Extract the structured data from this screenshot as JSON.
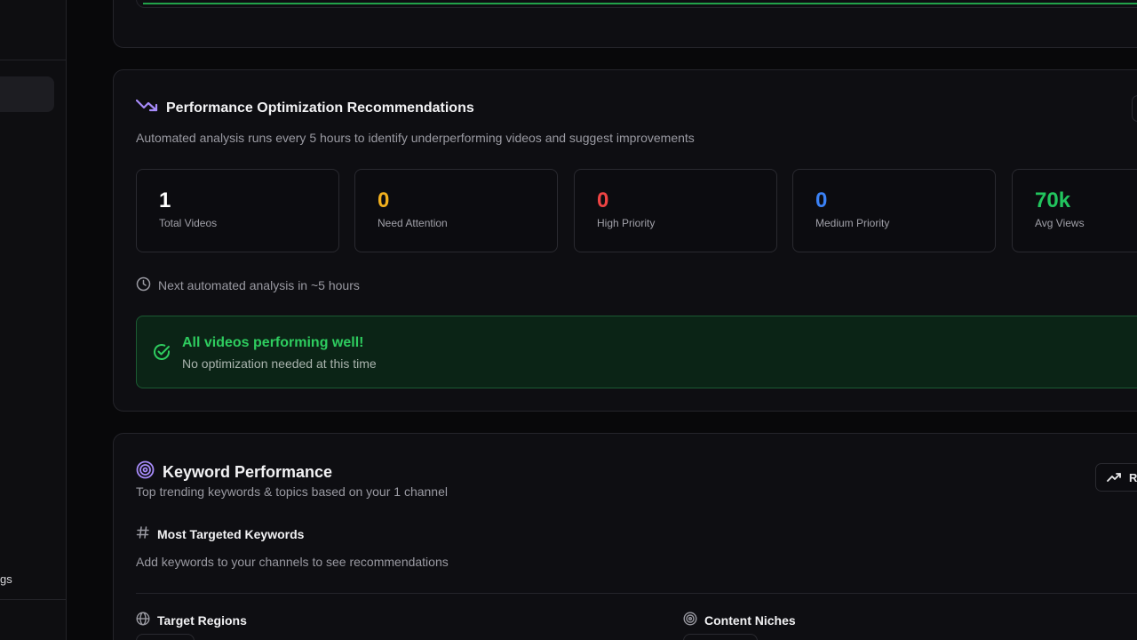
{
  "sidebar": {
    "partial_label": "gs"
  },
  "performance": {
    "title": "Performance Optimization Recommendations",
    "subtitle": "Automated analysis runs every 5 hours to identify underperforming videos and suggest improvements",
    "stats": [
      {
        "value": "1",
        "label": "Total Videos",
        "color": "#ffffff"
      },
      {
        "value": "0",
        "label": "Need Attention",
        "color": "#f2b01e"
      },
      {
        "value": "0",
        "label": "High Priority",
        "color": "#ef4444"
      },
      {
        "value": "0",
        "label": "Medium Priority",
        "color": "#3b82f6"
      },
      {
        "value": "70k",
        "label": "Avg Views",
        "color": "#22c55e"
      }
    ],
    "next_analysis": "Next automated analysis in ~5 hours",
    "status_title": "All videos performing well!",
    "status_subtitle": "No optimization needed at this time"
  },
  "keywords": {
    "title": "Keyword Performance",
    "subtitle": "Top trending keywords & topics based on your 1 channel",
    "trend_button_label": "R",
    "most_targeted_heading": "Most Targeted Keywords",
    "empty_message": "Add keywords to your channels to see recommendations",
    "regions_heading": "Target Regions",
    "niches_heading": "Content Niches"
  },
  "colors": {
    "accent_purple": "#a78bfa",
    "success_green": "#2ecc5f"
  }
}
